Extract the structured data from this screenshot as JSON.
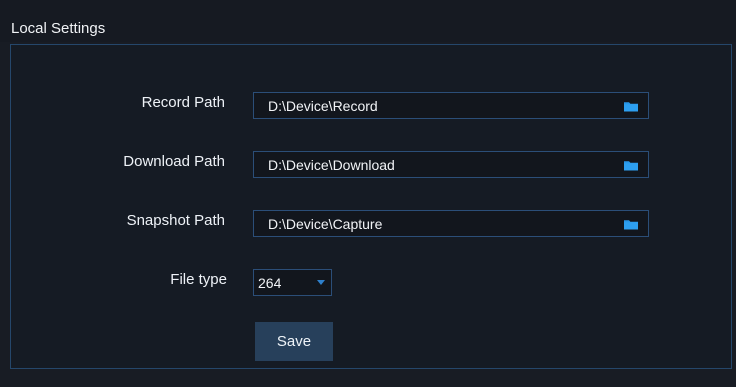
{
  "page": {
    "title": "Local Settings"
  },
  "settings": {
    "record_path": {
      "label": "Record Path",
      "value": "D:\\Device\\Record",
      "icon": "folder-icon"
    },
    "download_path": {
      "label": "Download Path",
      "value": "D:\\Device\\Download",
      "icon": "folder-icon"
    },
    "snapshot_path": {
      "label": "Snapshot Path",
      "value": "D:\\Device\\Capture",
      "icon": "folder-icon"
    },
    "file_type": {
      "label": "File type",
      "selected": "264",
      "icon": "chevron-down-icon"
    },
    "save_label": "Save"
  },
  "colors": {
    "background": "#181c24",
    "panel_border": "#25476b",
    "accent": "#2e80cc",
    "button": "#27405b"
  }
}
